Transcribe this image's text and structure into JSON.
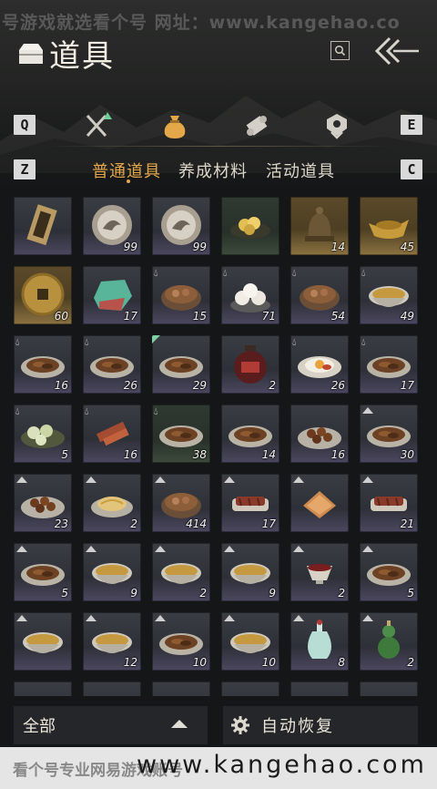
{
  "watermark": {
    "top": "号游戏就选看个号  网址：www.kangehao.co",
    "bottom_cn": "看个号专业网易游戏账号",
    "bottom_url": "www.kangehao.com"
  },
  "header": {
    "title": "道具",
    "title_icon": "item-chest-icon",
    "search_icon": "search-icon",
    "back_icon": "back-arrow-icon"
  },
  "category_tabs": {
    "prev_key": "Q",
    "next_key": "E",
    "items": [
      {
        "icon": "crossed-swords-icon",
        "active": false
      },
      {
        "icon": "money-bag-icon",
        "active": true
      },
      {
        "icon": "scroll-icon",
        "active": false
      },
      {
        "icon": "badge-icon",
        "active": false
      }
    ]
  },
  "sub_tabs": {
    "prev_key": "Z",
    "next_key": "C",
    "items": [
      {
        "label": "普通道具",
        "active": true
      },
      {
        "label": "养成材料",
        "active": false
      },
      {
        "label": "活动道具",
        "active": false
      }
    ]
  },
  "inventory": [
    {
      "icon": "ticket-icon",
      "count": "",
      "bg": "normal",
      "mark": ""
    },
    {
      "icon": "eagle-coin-icon",
      "count": "99",
      "bg": "normal",
      "mark": ""
    },
    {
      "icon": "eagle-coin-icon",
      "count": "99",
      "bg": "normal",
      "mark": ""
    },
    {
      "icon": "gold-nuggets-icon",
      "count": "",
      "bg": "green",
      "mark": ""
    },
    {
      "icon": "bell-icon",
      "count": "14",
      "bg": "gold",
      "mark": ""
    },
    {
      "icon": "gold-ingot-icon",
      "count": "45",
      "bg": "gold",
      "mark": ""
    },
    {
      "icon": "copper-coin-icon",
      "count": "60",
      "bg": "gold",
      "mark": ""
    },
    {
      "icon": "jade-ore-icon",
      "count": "17",
      "bg": "normal",
      "mark": ""
    },
    {
      "icon": "food-bowl-icon",
      "count": "15",
      "bg": "normal",
      "mark": "drop"
    },
    {
      "icon": "buns-icon",
      "count": "71",
      "bg": "normal",
      "mark": "drop"
    },
    {
      "icon": "food-bowl-icon",
      "count": "54",
      "bg": "normal",
      "mark": "drop"
    },
    {
      "icon": "soup-bowl-icon",
      "count": "49",
      "bg": "normal",
      "mark": "drop"
    },
    {
      "icon": "food-plate-icon",
      "count": "16",
      "bg": "normal",
      "mark": "drop"
    },
    {
      "icon": "food-plate-icon",
      "count": "26",
      "bg": "normal",
      "mark": "drop"
    },
    {
      "icon": "food-plate-icon",
      "count": "29",
      "bg": "normal",
      "mark": "flag"
    },
    {
      "icon": "wine-jar-icon",
      "count": "2",
      "bg": "normal",
      "mark": ""
    },
    {
      "icon": "egg-plate-icon",
      "count": "26",
      "bg": "normal",
      "mark": "drop"
    },
    {
      "icon": "food-plate-icon",
      "count": "17",
      "bg": "normal",
      "mark": "drop"
    },
    {
      "icon": "sliced-plate-icon",
      "count": "5",
      "bg": "normal",
      "mark": "drop"
    },
    {
      "icon": "skewer-icon",
      "count": "16",
      "bg": "normal",
      "mark": "drop"
    },
    {
      "icon": "food-plate-icon",
      "count": "38",
      "bg": "green",
      "mark": "drop"
    },
    {
      "icon": "food-plate-icon",
      "count": "14",
      "bg": "normal",
      "mark": ""
    },
    {
      "icon": "dumplings-icon",
      "count": "16",
      "bg": "normal",
      "mark": ""
    },
    {
      "icon": "food-plate-icon",
      "count": "30",
      "bg": "normal",
      "mark": "arrow"
    },
    {
      "icon": "dumplings-icon",
      "count": "23",
      "bg": "normal",
      "mark": "arrow"
    },
    {
      "icon": "noodle-plate-icon",
      "count": "2",
      "bg": "normal",
      "mark": "arrow"
    },
    {
      "icon": "food-bowl-icon",
      "count": "414",
      "bg": "normal",
      "mark": "arrow"
    },
    {
      "icon": "meat-plate-icon",
      "count": "17",
      "bg": "normal",
      "mark": "arrow"
    },
    {
      "icon": "cake-icon",
      "count": "",
      "bg": "normal",
      "mark": "arrow"
    },
    {
      "icon": "meat-plate-icon",
      "count": "21",
      "bg": "normal",
      "mark": "arrow"
    },
    {
      "icon": "food-plate-icon",
      "count": "5",
      "bg": "normal",
      "mark": "arrow"
    },
    {
      "icon": "soup-bowl-icon",
      "count": "9",
      "bg": "normal",
      "mark": "arrow"
    },
    {
      "icon": "soup-bowl-icon",
      "count": "2",
      "bg": "normal",
      "mark": "arrow"
    },
    {
      "icon": "soup-bowl-icon",
      "count": "9",
      "bg": "normal",
      "mark": "arrow"
    },
    {
      "icon": "wine-cup-icon",
      "count": "2",
      "bg": "normal",
      "mark": "arrow"
    },
    {
      "icon": "food-plate-icon",
      "count": "5",
      "bg": "normal",
      "mark": "arrow"
    },
    {
      "icon": "soup-bowl-icon",
      "count": "",
      "bg": "normal",
      "mark": "arrow"
    },
    {
      "icon": "soup-bowl-icon",
      "count": "12",
      "bg": "normal",
      "mark": "arrow"
    },
    {
      "icon": "food-plate-icon",
      "count": "10",
      "bg": "normal",
      "mark": "arrow"
    },
    {
      "icon": "soup-bowl-icon",
      "count": "10",
      "bg": "normal",
      "mark": "arrow"
    },
    {
      "icon": "porcelain-vase-icon",
      "count": "8",
      "bg": "normal",
      "mark": "arrow"
    },
    {
      "icon": "gourd-icon",
      "count": "2",
      "bg": "normal",
      "mark": "arrow"
    },
    {
      "icon": "food-plate-icon",
      "count": "",
      "bg": "normal",
      "mark": ""
    },
    {
      "icon": "food-plate-icon",
      "count": "",
      "bg": "normal",
      "mark": ""
    },
    {
      "icon": "food-plate-icon",
      "count": "",
      "bg": "normal",
      "mark": ""
    },
    {
      "icon": "food-plate-icon",
      "count": "",
      "bg": "normal",
      "mark": ""
    },
    {
      "icon": "food-plate-icon",
      "count": "",
      "bg": "normal",
      "mark": ""
    },
    {
      "icon": "food-plate-icon",
      "count": "",
      "bg": "normal",
      "mark": ""
    }
  ],
  "footer": {
    "filter_label": "全部",
    "auto_restore_label": "自动恢复",
    "gear_icon": "gear-icon",
    "caret_icon": "caret-up-icon"
  },
  "colors": {
    "accent": "#e4a84a",
    "panel": "#252629",
    "background": "#151617"
  }
}
